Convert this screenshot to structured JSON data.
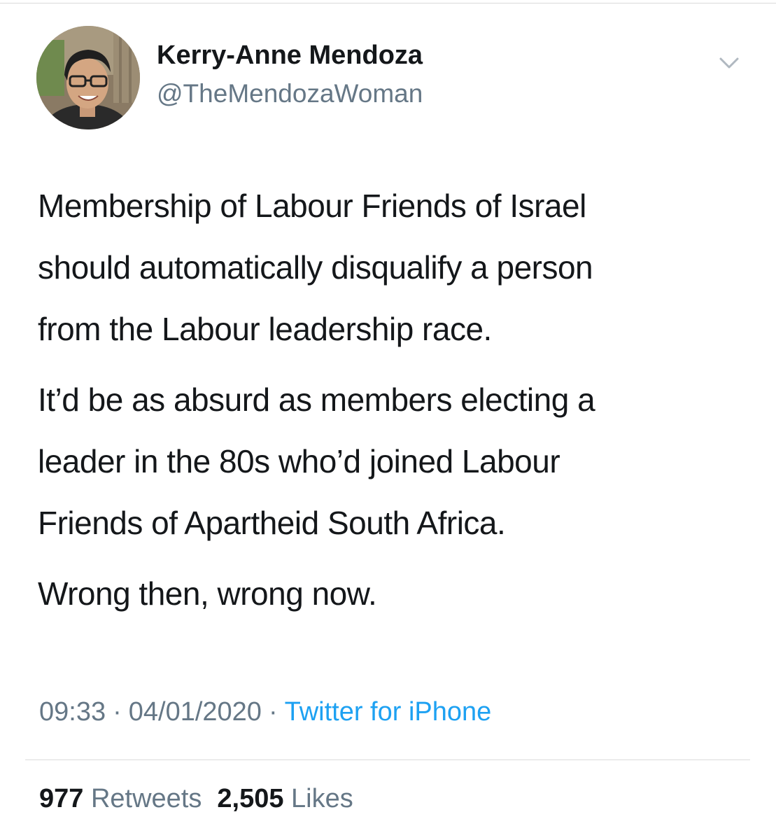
{
  "author": {
    "display_name": "Kerry-Anne Mendoza",
    "handle": "@TheMendozaWoman",
    "avatar": "profile-photo"
  },
  "menu_icon": "chevron-down-icon",
  "tweet": {
    "paragraphs": [
      "Membership of Labour Friends of Israel\nshould automatically disqualify a person\nfrom the Labour leadership race.",
      "It’d be as absurd as members electing a\nleader in the 80s who’d joined Labour\nFriends of Apartheid South Africa.",
      "Wrong then, wrong now."
    ]
  },
  "meta": {
    "time": "09:33",
    "date": "04/01/2020",
    "separator": "·",
    "source": "Twitter for iPhone"
  },
  "stats": {
    "retweets_count": "977",
    "retweets_label": "Retweets",
    "likes_count": "2,505",
    "likes_label": "Likes"
  },
  "colors": {
    "text_primary": "#14171a",
    "text_secondary": "#657786",
    "link": "#1da1f2",
    "divider": "#dcdcdc"
  }
}
